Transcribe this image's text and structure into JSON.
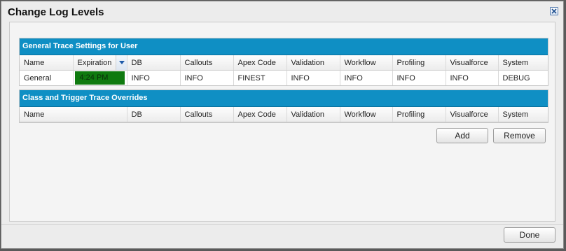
{
  "dialog": {
    "title": "Change Log Levels",
    "close_icon": "close-icon"
  },
  "general_section": {
    "title": "General Trace Settings for User",
    "columns": [
      "Name",
      "Expiration",
      "DB",
      "Callouts",
      "Apex Code",
      "Validation",
      "Workflow",
      "Profiling",
      "Visualforce",
      "System"
    ],
    "rows": [
      [
        "General",
        "4:24 PM",
        "INFO",
        "INFO",
        "FINEST",
        "INFO",
        "INFO",
        "INFO",
        "INFO",
        "DEBUG"
      ]
    ],
    "expiration_highlight_color": "#0f7a0f"
  },
  "overrides_section": {
    "title": "Class and Trigger Trace Overrides",
    "columns": [
      "Name",
      "DB",
      "Callouts",
      "Apex Code",
      "Validation",
      "Workflow",
      "Profiling",
      "Visualforce",
      "System"
    ],
    "rows": []
  },
  "buttons": {
    "add": "Add",
    "remove": "Remove",
    "done": "Done"
  },
  "colors": {
    "section_header": "#0f8fc4"
  }
}
